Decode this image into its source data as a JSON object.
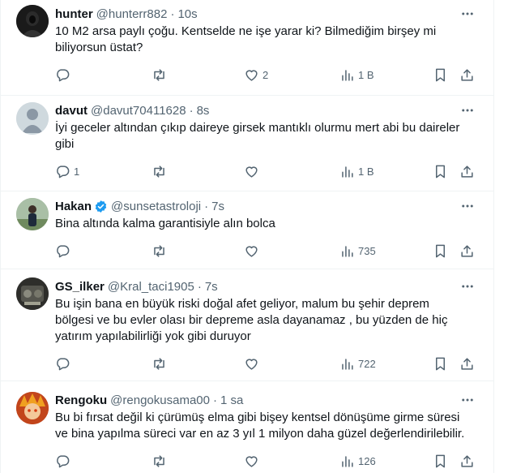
{
  "tweets": [
    {
      "name": "hunter",
      "handle": "@hunterr882",
      "time": "10s",
      "verified": false,
      "text_lines": [
        "10 M2 arsa paylı çoğu. Kentselde ne işe yarar ki? Bilmediğim birşey mi",
        "biliyorsun üstat?"
      ],
      "replies": "",
      "retweets": "",
      "likes": "2",
      "views": "1 B",
      "avatar": "dark-hooded-figure"
    },
    {
      "name": "davut",
      "handle": "@davut70411628",
      "time": "8s",
      "verified": false,
      "text_lines": [
        "İyi geceler altından çıkıp daireye girsek mantıklı olurmu mert abi bu daireler",
        "gibi"
      ],
      "replies": "1",
      "retweets": "",
      "likes": "",
      "views": "1 B",
      "avatar": "default-person"
    },
    {
      "name": "Hakan",
      "handle": "@sunsetastroloji",
      "time": "7s",
      "verified": true,
      "text_lines": [
        "Bina altında kalma garantisiyle alın bolca"
      ],
      "replies": "",
      "retweets": "",
      "likes": "",
      "views": "735",
      "avatar": "person-outdoors"
    },
    {
      "name": "GS_ilker",
      "handle": "@Kral_taci1905",
      "time": "7s",
      "verified": false,
      "text_lines": [
        "Bu işin bana en büyük riski doğal afet geliyor, malum  bu şehir deprem",
        "bölgesi ve bu evler olası bir depreme asla dayanamaz , bu yüzden de hiç",
        "yatırım yapılabilirliği yok gibi duruyor"
      ],
      "replies": "",
      "retweets": "",
      "likes": "",
      "views": "722",
      "avatar": "car-engine"
    },
    {
      "name": "Rengoku",
      "handle": "@rengokusama00",
      "time": "1 sa",
      "verified": false,
      "text_lines": [
        "Bu bi fırsat değil ki çürümüş elma gibi bişey kentsel dönüşüme girme süresi",
        "ve bina yapılma süreci var en az 3 yıl 1 milyon daha güzel değerlendirilebilir."
      ],
      "replies": "",
      "retweets": "",
      "likes": "",
      "views": "126",
      "avatar": "anime-character"
    }
  ],
  "sep": "·",
  "colors": {
    "text": "#0f1419",
    "secondary": "#536471",
    "border": "#eff3f4",
    "verified": "#1d9bf0"
  },
  "icons": {
    "reply": "reply-icon",
    "retweet": "retweet-icon",
    "like": "heart-icon",
    "views": "views-icon",
    "bookmark": "bookmark-icon",
    "share": "share-icon",
    "more": "more-icon"
  }
}
